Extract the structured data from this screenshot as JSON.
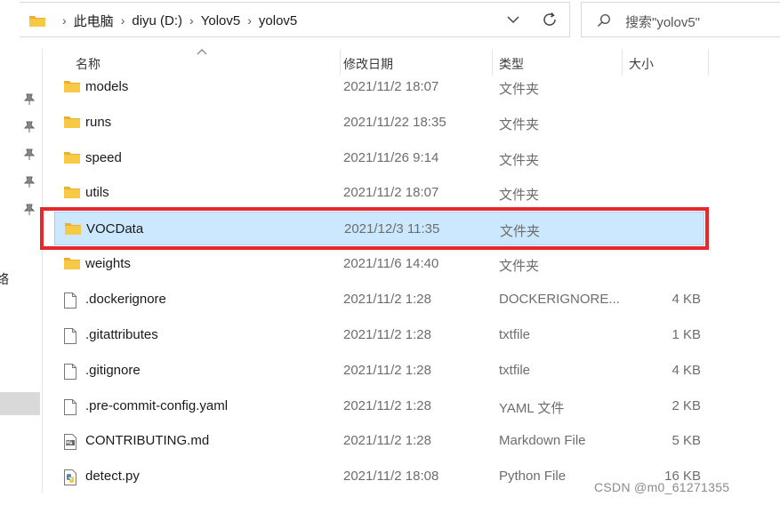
{
  "address": {
    "crumbs": [
      "此电脑",
      "diyu (D:)",
      "Yolov5",
      "yolov5"
    ]
  },
  "search": {
    "placeholder": "搜索\"yolov5\""
  },
  "nav": {
    "fragment": "络"
  },
  "columns": {
    "name": "名称",
    "modified": "修改日期",
    "type": "类型",
    "size": "大小"
  },
  "rows": [
    {
      "name": "models",
      "modified": "2021/11/2 18:07",
      "type": "文件夹",
      "size": "",
      "icon": "folder-icon"
    },
    {
      "name": "runs",
      "modified": "2021/11/22 18:35",
      "type": "文件夹",
      "size": "",
      "icon": "folder-icon"
    },
    {
      "name": "speed",
      "modified": "2021/11/26 9:14",
      "type": "文件夹",
      "size": "",
      "icon": "folder-icon"
    },
    {
      "name": "utils",
      "modified": "2021/11/2 18:07",
      "type": "文件夹",
      "size": "",
      "icon": "folder-icon"
    },
    {
      "name": "VOCData",
      "modified": "2021/12/3 11:35",
      "type": "文件夹",
      "size": "",
      "icon": "folder-icon",
      "selected": true
    },
    {
      "name": "weights",
      "modified": "2021/11/6 14:40",
      "type": "文件夹",
      "size": "",
      "icon": "folder-icon"
    },
    {
      "name": ".dockerignore",
      "modified": "2021/11/2 1:28",
      "type": "DOCKERIGNORE...",
      "size": "4 KB",
      "icon": "file-icon"
    },
    {
      "name": ".gitattributes",
      "modified": "2021/11/2 1:28",
      "type": "txtfile",
      "size": "1 KB",
      "icon": "file-icon"
    },
    {
      "name": ".gitignore",
      "modified": "2021/11/2 1:28",
      "type": "txtfile",
      "size": "4 KB",
      "icon": "file-icon"
    },
    {
      "name": ".pre-commit-config.yaml",
      "modified": "2021/11/2 1:28",
      "type": "YAML 文件",
      "size": "2 KB",
      "icon": "file-icon"
    },
    {
      "name": "CONTRIBUTING.md",
      "modified": "2021/11/2 1:28",
      "type": "Markdown File",
      "size": "5 KB",
      "icon": "markdown-file-icon"
    },
    {
      "name": "detect.py",
      "modified": "2021/11/2 18:08",
      "type": "Python File",
      "size": "16 KB",
      "icon": "python-file-icon"
    }
  ],
  "watermark": "CSDN @m0_61271355",
  "colors": {
    "selection_bg": "#cce8ff",
    "selection_border": "#99d1ff",
    "annotation_red": "#e8272c",
    "folder_yellow": "#f8c945"
  }
}
